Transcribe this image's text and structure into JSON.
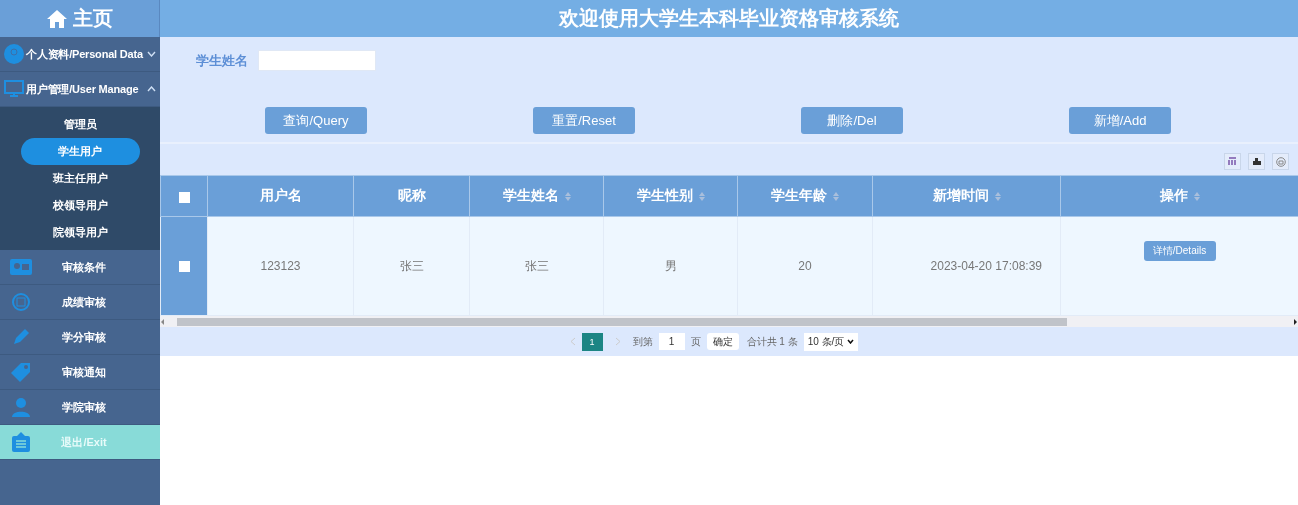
{
  "header": {
    "home": "主页",
    "title": "欢迎使用大学生本科毕业资格审核系统"
  },
  "sidebar": {
    "items": [
      {
        "kind": "group",
        "label": "个人资料/Personal Data",
        "expanded": false
      },
      {
        "kind": "group",
        "label": "用户管理/User Manage",
        "expanded": true,
        "children": [
          {
            "label": "管理员",
            "selected": false
          },
          {
            "label": "学生用户",
            "selected": true
          },
          {
            "label": "班主任用户",
            "selected": false
          },
          {
            "label": "校领导用户",
            "selected": false
          },
          {
            "label": "院领导用户",
            "selected": false
          }
        ]
      },
      {
        "kind": "item",
        "label": "审核条件"
      },
      {
        "kind": "item",
        "label": "成绩审核"
      },
      {
        "kind": "item",
        "label": "学分审核"
      },
      {
        "kind": "item",
        "label": "审核通知"
      },
      {
        "kind": "item",
        "label": "学院审核"
      },
      {
        "kind": "exit",
        "label": "退出/Exit"
      }
    ]
  },
  "search": {
    "label": "学生姓名"
  },
  "buttons": [
    "查询/Query",
    "重置/Reset",
    "删除/Del",
    "新增/Add"
  ],
  "table": {
    "all_checked": false,
    "columns": [
      {
        "label": "用户名",
        "sortable": false
      },
      {
        "label": "昵称",
        "sortable": false
      },
      {
        "label": "学生姓名",
        "sortable": true
      },
      {
        "label": "学生性别",
        "sortable": true
      },
      {
        "label": "学生年龄",
        "sortable": true
      },
      {
        "label": "新增时间",
        "sortable": true
      },
      {
        "label": "操作",
        "sortable": true
      }
    ],
    "rows": [
      {
        "checked": false,
        "cells": [
          "123123",
          "张三",
          "张三",
          "男",
          "20",
          "2023-04-20 17:08:39"
        ],
        "action": "详情/Details"
      }
    ]
  },
  "pagination": {
    "pages": [
      {
        "label": "1",
        "selected": true
      }
    ],
    "goto_label": "到第",
    "goto_value": "1",
    "page_unit": "页",
    "confirm": "确定",
    "total": "合计共 1 条",
    "page_size": "10 条/页"
  }
}
